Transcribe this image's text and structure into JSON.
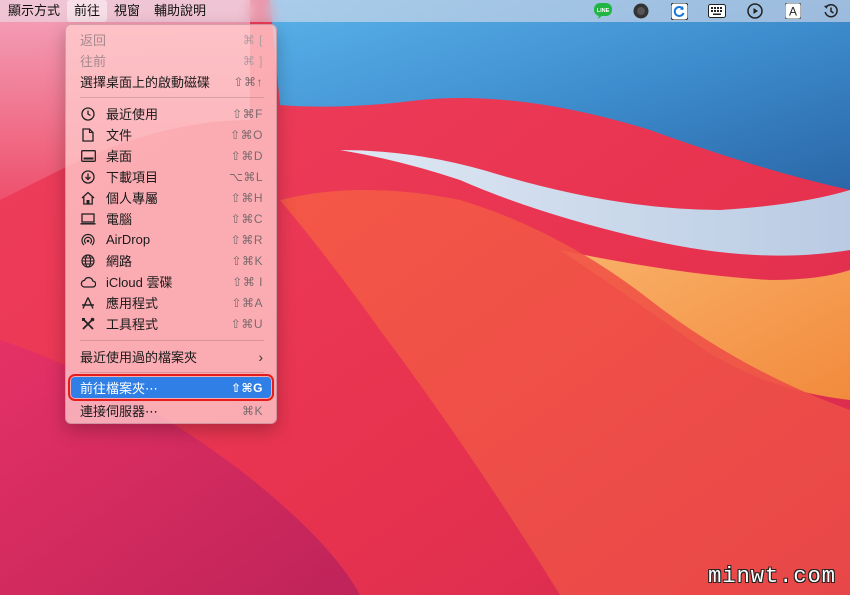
{
  "menubar": {
    "items": [
      {
        "label": "顯示方式"
      },
      {
        "label": "前往",
        "active": true
      },
      {
        "label": "視窗"
      },
      {
        "label": "輔助說明"
      }
    ],
    "status_icons": [
      "line-app-icon",
      "dark-circle-icon",
      "refresh-badge-icon",
      "keyboard-icon",
      "play-circle-icon",
      "input-source-icon",
      "time-machine-icon"
    ],
    "line_label": "LINE",
    "input_source_label": "A"
  },
  "menu": {
    "back": {
      "label": "返回",
      "shortcut": "⌘ ["
    },
    "forward": {
      "label": "往前",
      "shortcut": "⌘ ]"
    },
    "startup_disk": {
      "label": "選擇桌面上的啟動磁碟",
      "shortcut": "⇧⌘↑"
    },
    "places": [
      {
        "icon": "clock-icon",
        "label": "最近使用",
        "shortcut": "⇧⌘F"
      },
      {
        "icon": "document-icon",
        "label": "文件",
        "shortcut": "⇧⌘O"
      },
      {
        "icon": "desktop-icon",
        "label": "桌面",
        "shortcut": "⇧⌘D"
      },
      {
        "icon": "download-icon",
        "label": "下載項目",
        "shortcut": "⌥⌘L"
      },
      {
        "icon": "home-icon",
        "label": "個人專屬",
        "shortcut": "⇧⌘H"
      },
      {
        "icon": "computer-icon",
        "label": "電腦",
        "shortcut": "⇧⌘C"
      },
      {
        "icon": "airdrop-icon",
        "label": "AirDrop",
        "shortcut": "⇧⌘R"
      },
      {
        "icon": "network-icon",
        "label": "網路",
        "shortcut": "⇧⌘K"
      },
      {
        "icon": "cloud-icon",
        "label": "iCloud 雲碟",
        "shortcut": "⇧⌘ I"
      },
      {
        "icon": "applications-icon",
        "label": "應用程式",
        "shortcut": "⇧⌘A"
      },
      {
        "icon": "tools-icon",
        "label": "工具程式",
        "shortcut": "⇧⌘U"
      }
    ],
    "recent_folders": {
      "label": "最近使用過的檔案夾"
    },
    "go_to_folder": {
      "label": "前往檔案夾⋯",
      "shortcut": "⇧⌘G"
    },
    "connect_server": {
      "label": "連接伺服器⋯",
      "shortcut": "⌘K"
    }
  },
  "watermark": "minwt.com",
  "colors": {
    "highlight": "#2f7fe6",
    "annotation_box": "#e51c1c"
  }
}
